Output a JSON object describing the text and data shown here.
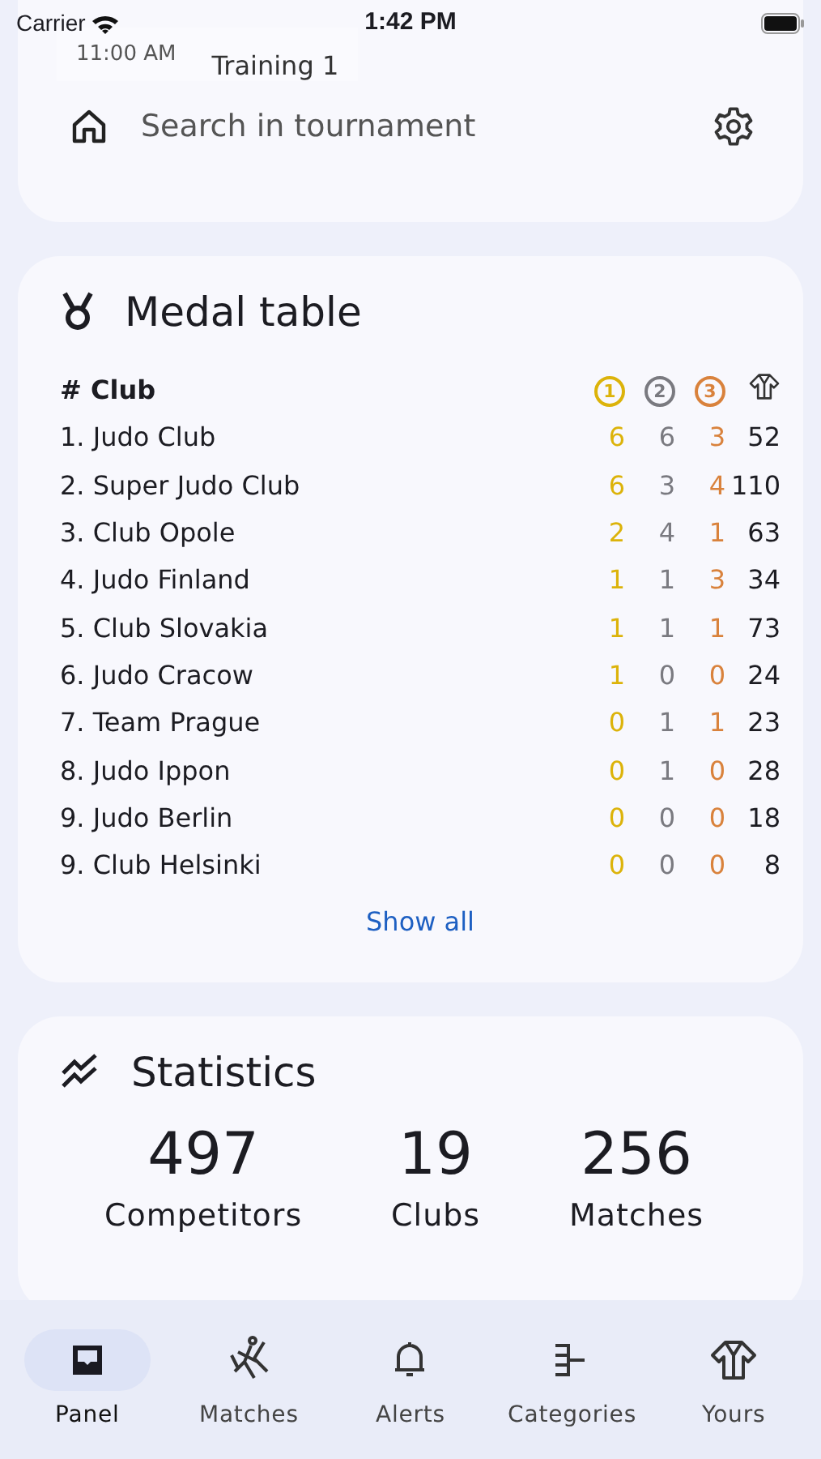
{
  "status_bar": {
    "carrier": "Carrier",
    "time": "1:42 PM"
  },
  "schedule": {
    "time": "11:00 AM",
    "title": "Training 1"
  },
  "search": {
    "placeholder": "Search in tournament"
  },
  "medal_table": {
    "title": "Medal table",
    "columns": [
      "# Club",
      "1",
      "2",
      "3"
    ],
    "rows": [
      {
        "club": "1. Judo Club",
        "gold": "6",
        "silver": "6",
        "bronze": "3",
        "total": "52"
      },
      {
        "club": "2. Super Judo Club",
        "gold": "6",
        "silver": "3",
        "bronze": "4",
        "total": "110"
      },
      {
        "club": "3. Club Opole",
        "gold": "2",
        "silver": "4",
        "bronze": "1",
        "total": "63"
      },
      {
        "club": "4. Judo Finland",
        "gold": "1",
        "silver": "1",
        "bronze": "3",
        "total": "34"
      },
      {
        "club": "5. Club Slovakia",
        "gold": "1",
        "silver": "1",
        "bronze": "1",
        "total": "73"
      },
      {
        "club": "6. Judo Cracow",
        "gold": "1",
        "silver": "0",
        "bronze": "0",
        "total": "24"
      },
      {
        "club": "7. Team Prague",
        "gold": "0",
        "silver": "1",
        "bronze": "1",
        "total": "23"
      },
      {
        "club": "8. Judo Ippon",
        "gold": "0",
        "silver": "1",
        "bronze": "0",
        "total": "28"
      },
      {
        "club": "9. Judo Berlin",
        "gold": "0",
        "silver": "0",
        "bronze": "0",
        "total": "18"
      },
      {
        "club": "9. Club Helsinki",
        "gold": "0",
        "silver": "0",
        "bronze": "0",
        "total": "8"
      }
    ],
    "show_all": "Show all"
  },
  "statistics": {
    "title": "Statistics",
    "items": [
      {
        "value": "497",
        "label": "Competitors"
      },
      {
        "value": "19",
        "label": "Clubs"
      },
      {
        "value": "256",
        "label": "Matches"
      }
    ]
  },
  "tabs": [
    {
      "label": "Panel",
      "selected": true
    },
    {
      "label": "Matches",
      "selected": false
    },
    {
      "label": "Alerts",
      "selected": false
    },
    {
      "label": "Categories",
      "selected": false
    },
    {
      "label": "Yours",
      "selected": false
    }
  ]
}
